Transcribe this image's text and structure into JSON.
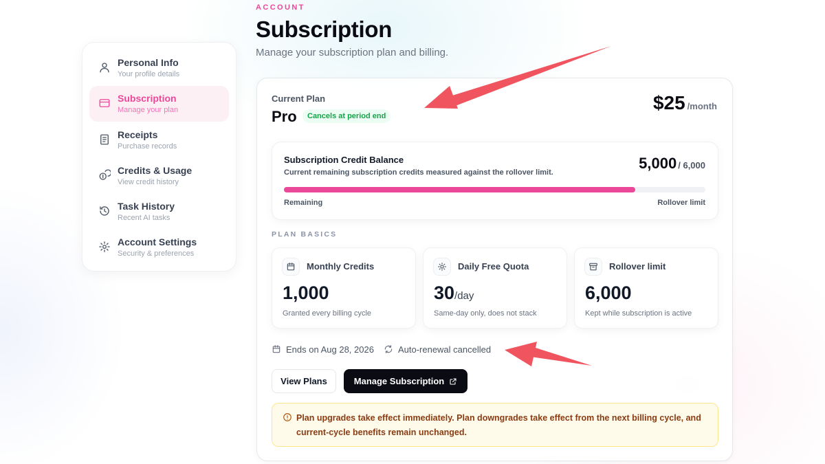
{
  "header": {
    "eyebrow": "ACCOUNT",
    "title": "Subscription",
    "description": "Manage your subscription plan and billing."
  },
  "sidebar": {
    "items": [
      {
        "label": "Personal Info",
        "sub": "Your profile details",
        "icon": "user-icon",
        "active": false
      },
      {
        "label": "Subscription",
        "sub": "Manage your plan",
        "icon": "credit-card-icon",
        "active": true
      },
      {
        "label": "Receipts",
        "sub": "Purchase records",
        "icon": "receipt-icon",
        "active": false
      },
      {
        "label": "Credits & Usage",
        "sub": "View credit history",
        "icon": "coins-icon",
        "active": false
      },
      {
        "label": "Task History",
        "sub": "Recent AI tasks",
        "icon": "history-icon",
        "active": false
      },
      {
        "label": "Account Settings",
        "sub": "Security & preferences",
        "icon": "gear-icon",
        "active": false
      }
    ]
  },
  "plan": {
    "label": "Current Plan",
    "name": "Pro",
    "badge": "Cancels at period end",
    "price": "$25",
    "period": "/month"
  },
  "balance": {
    "title": "Subscription Credit Balance",
    "description": "Current remaining subscription credits measured against the rollover limit.",
    "current": "5,000",
    "max": "/ 6,000",
    "progress_fraction": 0.833,
    "left_label": "Remaining",
    "right_label": "Rollover limit"
  },
  "basics": {
    "label": "PLAN BASICS",
    "cards": [
      {
        "title": "Monthly Credits",
        "value": "1,000",
        "unit": "",
        "note": "Granted every billing cycle",
        "icon": "calendar-icon"
      },
      {
        "title": "Daily Free Quota",
        "value": "30",
        "unit": "/day",
        "note": "Same-day only, does not stack",
        "icon": "sun-icon"
      },
      {
        "title": "Rollover limit",
        "value": "6,000",
        "unit": "",
        "note": "Kept while subscription is active",
        "icon": "archive-icon"
      }
    ]
  },
  "meta": {
    "ends": "Ends on Aug 28, 2026",
    "renewal": "Auto-renewal cancelled"
  },
  "actions": {
    "view_plans": "View Plans",
    "manage": "Manage Subscription"
  },
  "notice": {
    "text": "Plan upgrades take effect immediately. Plan downgrades take effect from the next billing cycle, and current-cycle benefits remain unchanged."
  },
  "colors": {
    "accent": "#ec4899",
    "annotation_arrow": "#f0545f",
    "badge_green": "#16a34a",
    "notice_text": "#8a3b12"
  }
}
